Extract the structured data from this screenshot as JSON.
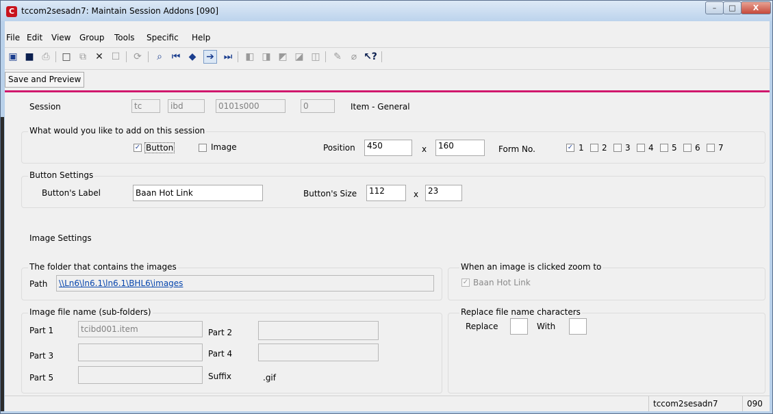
{
  "window": {
    "title": "tccom2sesadn7: Maintain Session Addons [090]",
    "controls": {
      "minimize": "–",
      "maximize": "□",
      "close": "X"
    },
    "app_icon_letter": "C"
  },
  "menu": [
    "File",
    "Edit",
    "View",
    "Group",
    "Tools",
    "Specific",
    "Help"
  ],
  "toolbar": {
    "icons": [
      "open-icon",
      "save-icon",
      "print-icon",
      "new-icon",
      "copy-icon",
      "delete-icon",
      "properties-icon",
      "refresh-icon",
      "find-icon",
      "first-record-icon",
      "previous-record-icon",
      "next-record-icon",
      "last-record-icon",
      "group-icon-1",
      "group-icon-2",
      "group-icon-3",
      "group-icon-4",
      "group-icon-5",
      "text-icon",
      "attach-icon",
      "help-icon"
    ]
  },
  "save_preview": "Save and Preview",
  "session": {
    "label": "Session",
    "fields": [
      "tc",
      "ibd",
      "0101s000",
      "0"
    ],
    "description": "Item - General"
  },
  "add_group": {
    "title": "What would you like to add on this session",
    "button_label": "Button",
    "button_checked": true,
    "image_label": "Image",
    "image_checked": false,
    "position_label": "Position",
    "position_x": "450",
    "x_sep": "x",
    "position_y": "160",
    "form_label": "Form No.",
    "forms": [
      {
        "n": "1",
        "checked": true
      },
      {
        "n": "2",
        "checked": false
      },
      {
        "n": "3",
        "checked": false
      },
      {
        "n": "4",
        "checked": false
      },
      {
        "n": "5",
        "checked": false
      },
      {
        "n": "6",
        "checked": false
      },
      {
        "n": "7",
        "checked": false
      }
    ]
  },
  "button_settings": {
    "title": "Button Settings",
    "label_label": "Button's Label",
    "label_value": "Baan Hot Link",
    "size_label": "Button's Size",
    "width": "112",
    "x_sep": "x",
    "height": "23"
  },
  "image_settings": {
    "title": "Image Settings",
    "folder_group_title": "The folder that contains the images",
    "path_label": "Path",
    "path_value": "\\\\Ln6\\ln6.1\\ln6.1\\BHL6\\images",
    "zoom_group_title": "When an image is clicked zoom to",
    "zoom_option": "Baan Hot Link",
    "zoom_checked": true,
    "filename_group_title": "Image file name (sub-folders)",
    "part1_label": "Part 1",
    "part1_value": "tcibd001.item",
    "part2_label": "Part 2",
    "part2_value": "",
    "part3_label": "Part 3",
    "part3_value": "",
    "part4_label": "Part 4",
    "part4_value": "",
    "part5_label": "Part 5",
    "part5_value": "",
    "suffix_label": "Suffix",
    "suffix_value": ".gif",
    "replace_group_title": "Replace file name characters",
    "replace_label": "Replace",
    "replace_value": "",
    "with_label": "With",
    "with_value": ""
  },
  "status": {
    "session": "tccom2sesadn7",
    "company": "090"
  }
}
